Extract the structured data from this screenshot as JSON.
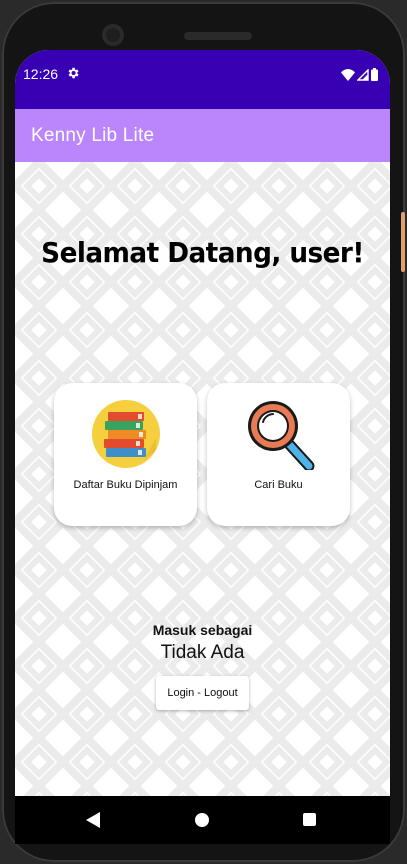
{
  "status_bar": {
    "time": "12:26",
    "icons": [
      "settings-icon",
      "wifi-icon",
      "cell-signal-icon",
      "battery-icon"
    ]
  },
  "app_bar": {
    "title": "Kenny Lib Lite"
  },
  "main": {
    "welcome": "Selamat Datang, user!",
    "cards": [
      {
        "label": "Daftar Buku Dipinjam",
        "icon": "books-icon"
      },
      {
        "label": "Cari Buku",
        "icon": "magnifier-icon"
      }
    ],
    "masuk_label": "Masuk sebagai",
    "masuk_value": "Tidak Ada",
    "login_button": "Login - Logout"
  },
  "nav_bar": {
    "icons": [
      "back-icon",
      "home-icon",
      "recents-icon"
    ]
  },
  "colors": {
    "status_bar": "#3700b3",
    "app_bar": "#bb86fc",
    "pattern": "#eeeeee"
  }
}
